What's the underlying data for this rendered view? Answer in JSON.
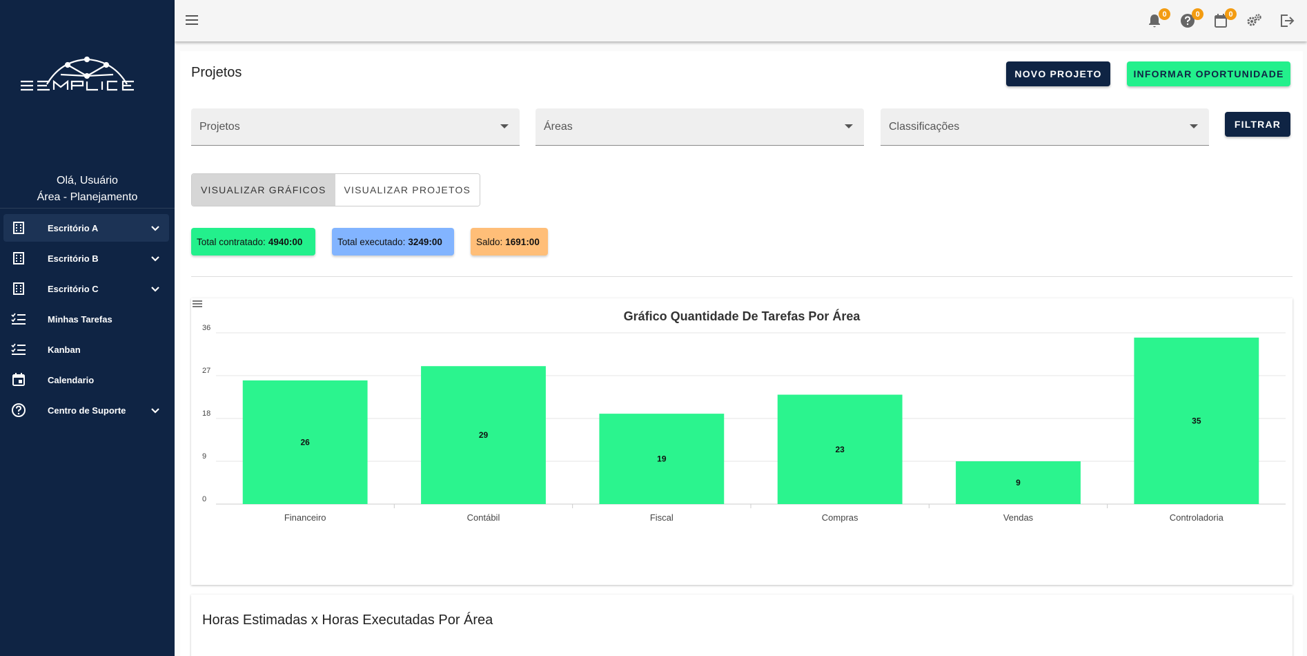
{
  "sidebar": {
    "greeting": "Olá, Usuário",
    "area": "Área - Planejamento",
    "items": [
      {
        "label": "Escritório A",
        "icon": "building-icon",
        "expandable": true,
        "active": true
      },
      {
        "label": "Escritório B",
        "icon": "building-icon",
        "expandable": true
      },
      {
        "label": "Escritório C",
        "icon": "building-icon",
        "expandable": true
      },
      {
        "label": "Minhas Tarefas",
        "icon": "checklist-icon"
      },
      {
        "label": "Kanban",
        "icon": "checklist-icon"
      },
      {
        "label": "Calendario",
        "icon": "calendar-icon"
      },
      {
        "label": "Centro de Suporte",
        "icon": "help-circle-icon",
        "expandable": true
      }
    ]
  },
  "topbar": {
    "badges": {
      "notifications": "0",
      "help": "0",
      "calendar": "0"
    }
  },
  "page": {
    "title": "Projetos",
    "new_project": "NOVO PROJETO",
    "inform_opportunity": "INFORMAR OPORTUNIDADE",
    "filters": {
      "projects": "Projetos",
      "areas": "Áreas",
      "classifications": "Classificações"
    },
    "filter_button": "FILTRAR",
    "view_charts": "VISUALIZAR GRÁFICOS",
    "view_projects": "VISUALIZAR PROJETOS"
  },
  "totals": {
    "contracted_label": "Total contratado:",
    "contracted_value": "4940:00",
    "executed_label": "Total executado:",
    "executed_value": "3249:00",
    "balance_label": "Saldo:",
    "balance_value": "1691:00"
  },
  "colors": {
    "sidebar": "#0f2444",
    "accent_green": "#23f08c",
    "bar": "#2bf48e",
    "chip_green": "#23f08c",
    "chip_blue": "#82b4ff",
    "chip_orange": "#ffbe78"
  },
  "chart_data": {
    "type": "bar",
    "title": "Gráfico Quantidade De Tarefas Por Área",
    "categories": [
      "Financeiro",
      "Contábil",
      "Fiscal",
      "Compras",
      "Vendas",
      "Controladoria"
    ],
    "values": [
      26,
      29,
      19,
      23,
      9,
      35
    ],
    "yticks": [
      0,
      9,
      18,
      27,
      36
    ],
    "ylim": [
      0,
      36
    ],
    "grid": true,
    "data_labels": true
  },
  "second_card": {
    "title": "Horas Estimadas x Horas Executadas Por Área"
  }
}
